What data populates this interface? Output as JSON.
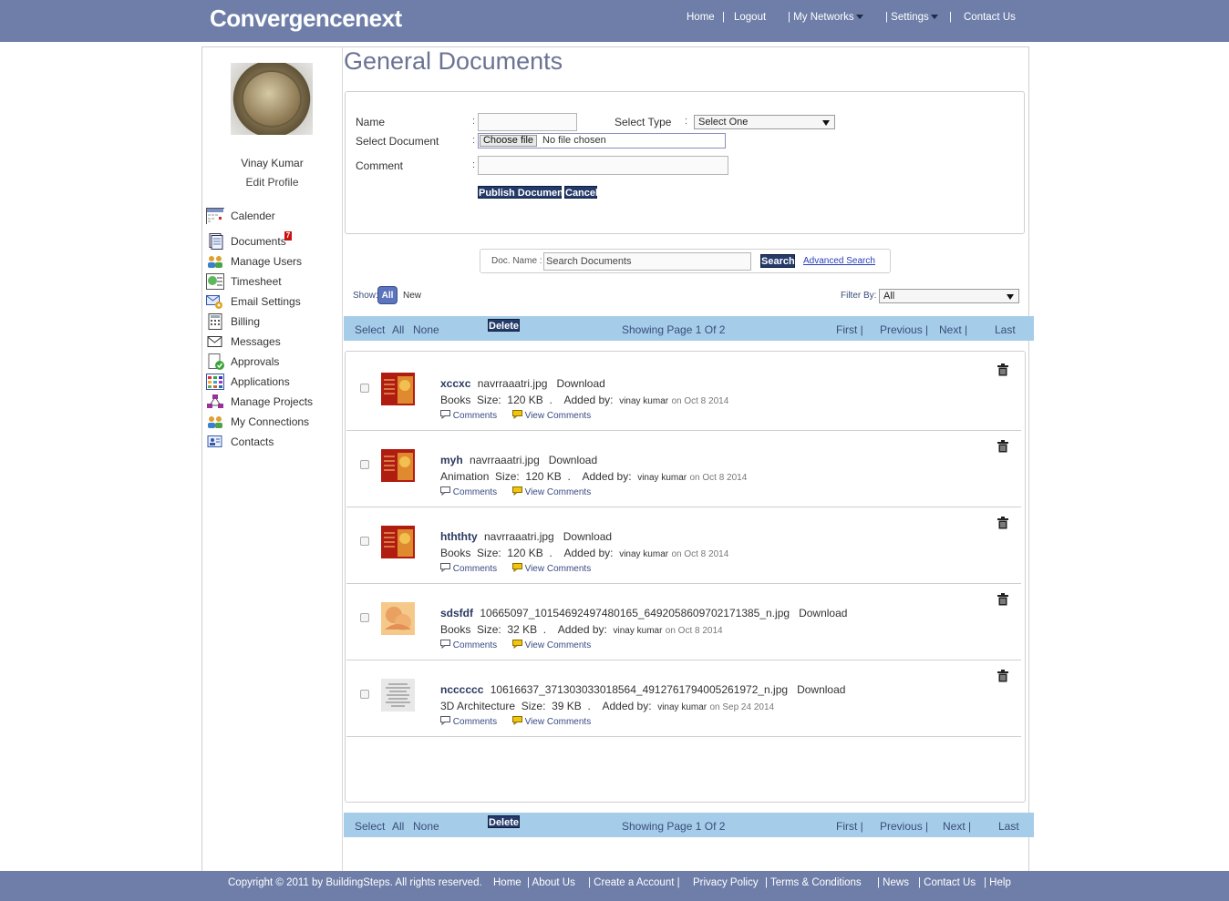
{
  "header": {
    "brand": "Convergencenext",
    "nav": {
      "home": "Home",
      "sep1": "|",
      "logout": "Logout",
      "networks": "| My Networks",
      "settings": "| Settings",
      "sep2": "|",
      "contact": "Contact Us"
    }
  },
  "profile": {
    "name": "Vinay Kumar",
    "edit": "Edit Profile"
  },
  "sidebar": {
    "items": [
      {
        "label": "Calender",
        "icon": "calendar-icon"
      },
      {
        "label": "Documents",
        "icon": "documents-icon",
        "badge": "7"
      },
      {
        "label": "Manage Users",
        "icon": "users-icon"
      },
      {
        "label": "Timesheet",
        "icon": "timesheet-icon"
      },
      {
        "label": "Email Settings",
        "icon": "email-settings-icon"
      },
      {
        "label": "Billing",
        "icon": "billing-icon"
      },
      {
        "label": "Messages",
        "icon": "messages-icon"
      },
      {
        "label": "Approvals",
        "icon": "approvals-icon"
      },
      {
        "label": "Applications",
        "icon": "applications-icon"
      },
      {
        "label": "Manage Projects",
        "icon": "projects-icon"
      },
      {
        "label": "My Connections",
        "icon": "connections-icon"
      },
      {
        "label": "Contacts",
        "icon": "contacts-icon"
      }
    ]
  },
  "page_title": "General Documents",
  "form": {
    "name_label": "Name",
    "colon": ":",
    "select_type_label": "Select Type",
    "select_type_value": "Select One",
    "select_doc_label": "Select Document",
    "choose_file": "Choose file",
    "no_file": "No file chosen",
    "comment_label": "Comment",
    "publish": "Publish Document",
    "cancel": "Cancel"
  },
  "search": {
    "label": "Doc. Name :",
    "placeholder": "Search Documents",
    "button": "Search",
    "advanced": "Advanced Search"
  },
  "show": {
    "label": "Show:",
    "all": "All",
    "new": "New"
  },
  "filter": {
    "label": "Filter By:",
    "value": "All"
  },
  "pager": {
    "select": "Select",
    "all": "All",
    "none": "None",
    "delete": "Delete",
    "status": "Showing Page 1 Of 2",
    "first": "First |",
    "previous": "Previous |",
    "next": "Next |",
    "last": "Last"
  },
  "documents": [
    {
      "title": "xccxc",
      "file": "navrraaatri.jpg",
      "download": "Download",
      "type": "Books",
      "size_label": "Size:",
      "size": "120 KB",
      "dot": ".",
      "added_label": "Added by:",
      "user": "vinay kumar",
      "date": "on Oct 8 2014",
      "comments": "Comments",
      "view_comments": "View Comments"
    },
    {
      "title": "myh",
      "file": "navrraaatri.jpg",
      "download": "Download",
      "type": "Animation",
      "size_label": "Size:",
      "size": "120 KB",
      "dot": ".",
      "added_label": "Added by:",
      "user": "vinay kumar",
      "date": "on Oct 8 2014",
      "comments": "Comments",
      "view_comments": "View Comments"
    },
    {
      "title": "hththty",
      "file": "navrraaatri.jpg",
      "download": "Download",
      "type": "Books",
      "size_label": "Size:",
      "size": "120 KB",
      "dot": ".",
      "added_label": "Added by:",
      "user": "vinay kumar",
      "date": "on Oct 8 2014",
      "comments": "Comments",
      "view_comments": "View Comments"
    },
    {
      "title": "sdsfdf",
      "file": "10665097_10154692497480165_6492058609702171385_n.jpg",
      "download": "Download",
      "type": "Books",
      "size_label": "Size:",
      "size": "32 KB",
      "dot": ".",
      "added_label": "Added by:",
      "user": "vinay kumar",
      "date": "on Oct 8 2014",
      "comments": "Comments",
      "view_comments": "View Comments"
    },
    {
      "title": "ncccccc",
      "file": "10616637_371303033018564_4912761794005261972_n.jpg",
      "download": "Download",
      "type": "3D Architecture",
      "size_label": "Size:",
      "size": "39 KB",
      "dot": ".",
      "added_label": "Added by:",
      "user": "vinay kumar",
      "date": "on Sep 24 2014",
      "comments": "Comments",
      "view_comments": "View Comments"
    }
  ],
  "footer": {
    "copyright": "Copyright © 2011 by BuildingSteps. All rights reserved.",
    "home": "Home",
    "about": "| About Us",
    "create": "| Create a Account |",
    "privacy": "Privacy Policy",
    "terms": "|  Terms & Conditions",
    "news": "|  News",
    "contact": "|  Contact Us",
    "help": "|  Help"
  }
}
